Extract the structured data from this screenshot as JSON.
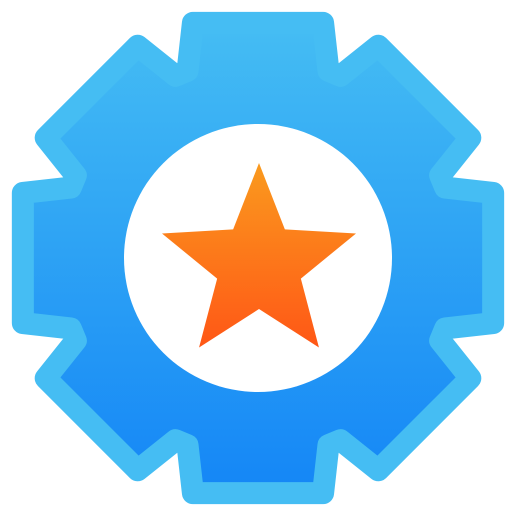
{
  "icon": {
    "name": "gear-star-icon",
    "gear": {
      "name": "gear-icon",
      "teeth": 8,
      "gradient_top": "#45BDF3",
      "gradient_bottom": "#1486F6"
    },
    "inner_disc": {
      "name": "gear-center-disc",
      "color": "#FFFFFF"
    },
    "star": {
      "name": "star-icon",
      "points": 5,
      "gradient_top": "#FA9A1E",
      "gradient_bottom": "#FF5716"
    }
  }
}
